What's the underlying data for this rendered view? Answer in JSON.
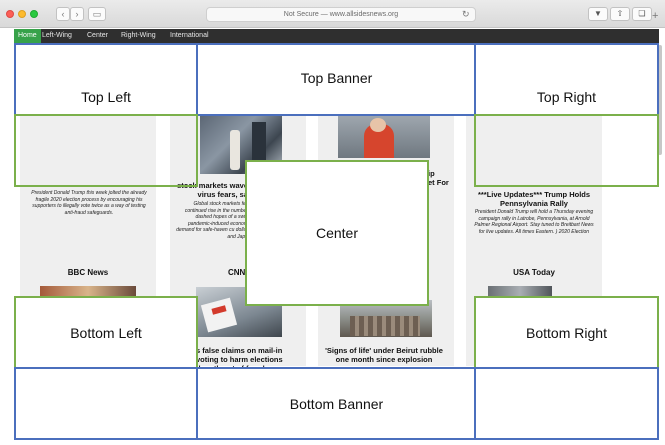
{
  "browser": {
    "address": "Not Secure — www.allsidesnews.org",
    "reload_icon": "reload-icon",
    "back_icon": "back-icon",
    "forward_icon": "forward-icon",
    "sidebar_icon": "sidebar-icon",
    "download_icon": "download-icon",
    "share_icon": "share-icon",
    "tabs_icon": "tabs-icon",
    "new_tab": "+"
  },
  "nav": {
    "items": [
      "Home",
      "Left-Wing",
      "Center",
      "Right-Wing",
      "International"
    ],
    "active_color": "#37a24a"
  },
  "overlay": {
    "top_left": "Top Left",
    "top_banner": "Top Banner",
    "top_right": "Top Right",
    "center": "Center",
    "bottom_left": "Bottom Left",
    "bottom_right": "Bottom Right",
    "bottom_banner": "Bottom Banner",
    "banner_color": "#4b6fbd",
    "corner_color": "#7bb04b"
  },
  "articles": {
    "col1_blurb": "President Donald Trump this week jolted the already fragile 2020 election process by encouraging his supporters to illegally vote twice as a way of testing anti-fraud safeguards.",
    "col2_headline": "stock markets wave virus fears, sa",
    "col2_blurb": "Global stock markets fell continued rise in the number dashed hopes of a swift pandemic-induced econom demand for safe-haven cu dollar and Japa",
    "col3_headline_frag1": "ip",
    "col3_headline_frag2": "et For",
    "col4_headline": "***Live Updates*** Trump Holds Pennsylvania Rally",
    "col4_blurb": "President Donald Trump will hold a Thursday evening campaign rally in Latrobe, Pennsylvania, at Arnold Palmer Regional Airport. Stay tuned to Breitbart News for live updates. All times Eastern. ) 2020 Election",
    "sources": [
      "BBC News",
      "CNN",
      "USA Today"
    ],
    "bottom_col2_headline": "s false claims on mail-in voting to harm elections than threat of fraud, experts say",
    "bottom_col3_headline": "'Signs of life' under Beirut rubble one month since explosion"
  }
}
